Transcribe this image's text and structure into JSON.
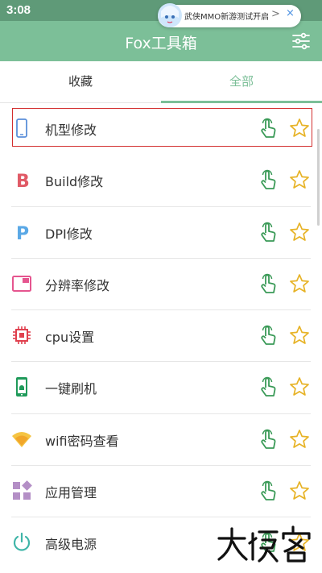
{
  "status_bar": {
    "time": "3:08"
  },
  "notification": {
    "message": "武侠MMO新游测试开启!",
    "arrow": ">",
    "close": "×"
  },
  "app_bar": {
    "title": "Fox工具箱",
    "filter_icon": "filter-sliders-icon"
  },
  "tabs": [
    {
      "label": "收藏",
      "active": false
    },
    {
      "label": "全部",
      "active": true
    }
  ],
  "list": [
    {
      "label": "机型修改",
      "icon": "phone-icon",
      "selected": true
    },
    {
      "label": "Build修改",
      "icon": "letter-b-icon"
    },
    {
      "label": "DPI修改",
      "icon": "letter-p-icon"
    },
    {
      "label": "分辨率修改",
      "icon": "screen-icon"
    },
    {
      "label": "cpu设置",
      "icon": "chip-icon"
    },
    {
      "label": "一键刷机",
      "icon": "android-phone-icon"
    },
    {
      "label": "wifi密码查看",
      "icon": "wifi-icon"
    },
    {
      "label": "应用管理",
      "icon": "apps-icon"
    },
    {
      "label": "高级电源",
      "icon": "power-icon"
    }
  ],
  "colors": {
    "accent": "#7cbf98",
    "status_bar": "#5f9a78",
    "action_green": "#3a9a57",
    "star": "#e7b327",
    "highlight": "#d32f2f"
  }
}
